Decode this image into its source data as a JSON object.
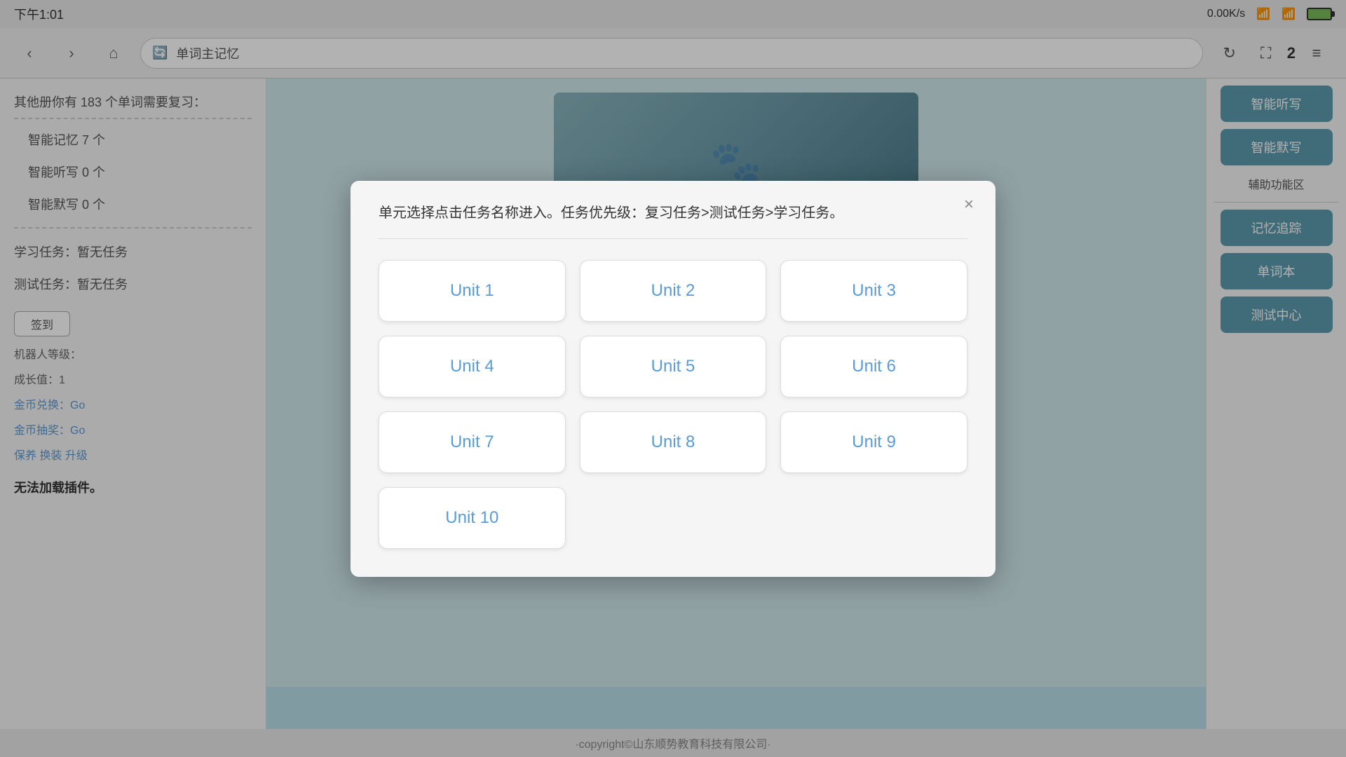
{
  "statusBar": {
    "time": "下午1:01",
    "speed": "0.00K/s",
    "wifi": "WiFi",
    "battery": ""
  },
  "navBar": {
    "back": "‹",
    "forward": "›",
    "home": "⌂",
    "url_icon": "🔄",
    "url_text": "单词主记忆",
    "refresh": "↻",
    "fullscreen": "⛶",
    "badge": "2",
    "menu": "≡"
  },
  "leftSidebar": {
    "reviewNotice": "其他册你有 183 个单词需要复习：",
    "stats": [
      "智能记忆 7 个",
      "智能听写 0 个",
      "智能默写 0 个"
    ],
    "tasks": [
      "学习任务：暂无任务",
      "测试任务：暂无任务"
    ],
    "checkin": "签到",
    "robotLevel": "机器人等级：",
    "growth": "成长值：1",
    "coinExchange": "金币兑换：Go",
    "coinDraw": "金币抽奖：Go",
    "maintain": "保养 换装 升级",
    "noPlugin": "无法加载插件。"
  },
  "rightSidebar": {
    "buttons": [
      "智能听写",
      "智能默写",
      "记忆追踪",
      "单词本",
      "测试中心"
    ],
    "sectionLabel": "辅助功能区"
  },
  "footer": {
    "copyright": "·copyright©山东顺势教育科技有限公司·"
  },
  "modal": {
    "message": "单元选择点击任务名称进入。任务优先级：复习任务>测试任务>学习任务。",
    "closeLabel": "×",
    "units": [
      "Unit 1",
      "Unit 2",
      "Unit 3",
      "Unit 4",
      "Unit 5",
      "Unit 6",
      "Unit 7",
      "Unit 8",
      "Unit 9",
      "Unit 10"
    ]
  }
}
